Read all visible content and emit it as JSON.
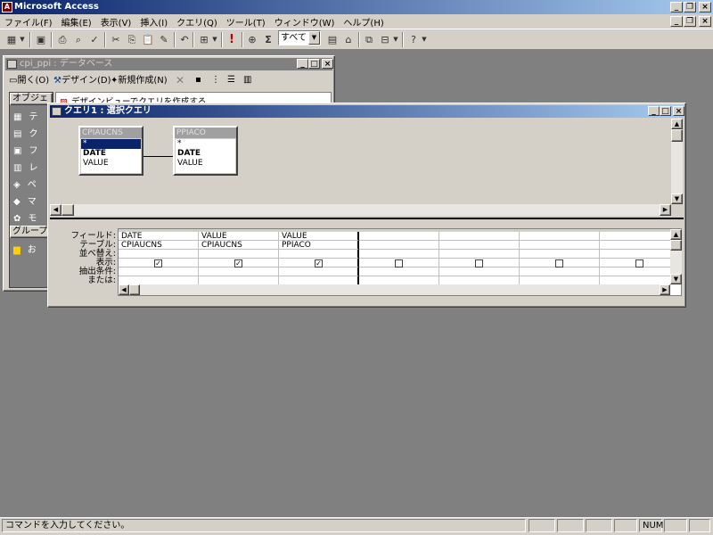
{
  "app": {
    "title": "Microsoft Access"
  },
  "menu": [
    "ファイル(F)",
    "編集(E)",
    "表示(V)",
    "挿入(I)",
    "クエリ(Q)",
    "ツール(T)",
    "ウィンドウ(W)",
    "ヘルプ(H)"
  ],
  "toolbar": {
    "topvalues": "すべて",
    "sigma": "Σ",
    "run": "!"
  },
  "dbwindow": {
    "title": "cpi_ppi : データベース",
    "open": "開く(O)",
    "design": "デザイン(D)",
    "new": "新規作成(N)",
    "objects_header": "オブジェ",
    "groups_header": "グループ",
    "items": [
      "テ",
      "ク",
      "フ",
      "レ",
      "ペ",
      "マ",
      "モ"
    ],
    "group_item": "お",
    "list_item": "デザインビューでクエリを作成する"
  },
  "query": {
    "title": "クエリ1 : 選択クエリ",
    "tables": [
      {
        "name": "CPIAUCNS",
        "fields": [
          "*",
          "DATE",
          "VALUE"
        ]
      },
      {
        "name": "PPIACO",
        "fields": [
          "*",
          "DATE",
          "VALUE"
        ]
      }
    ],
    "row_labels": [
      "フィールド:",
      "テーブル:",
      "並べ替え:",
      "表示:",
      "抽出条件:",
      "または:"
    ],
    "columns": [
      {
        "field": "DATE",
        "table": "CPIAUCNS",
        "show": true
      },
      {
        "field": "VALUE",
        "table": "CPIAUCNS",
        "show": true
      },
      {
        "field": "VALUE",
        "table": "PPIACO",
        "show": true
      },
      {
        "field": "",
        "table": "",
        "show": false
      },
      {
        "field": "",
        "table": "",
        "show": false
      },
      {
        "field": "",
        "table": "",
        "show": false
      },
      {
        "field": "",
        "table": "",
        "show": false
      }
    ]
  },
  "status": {
    "message": "コマンドを入力してください。",
    "num": "NUM"
  }
}
